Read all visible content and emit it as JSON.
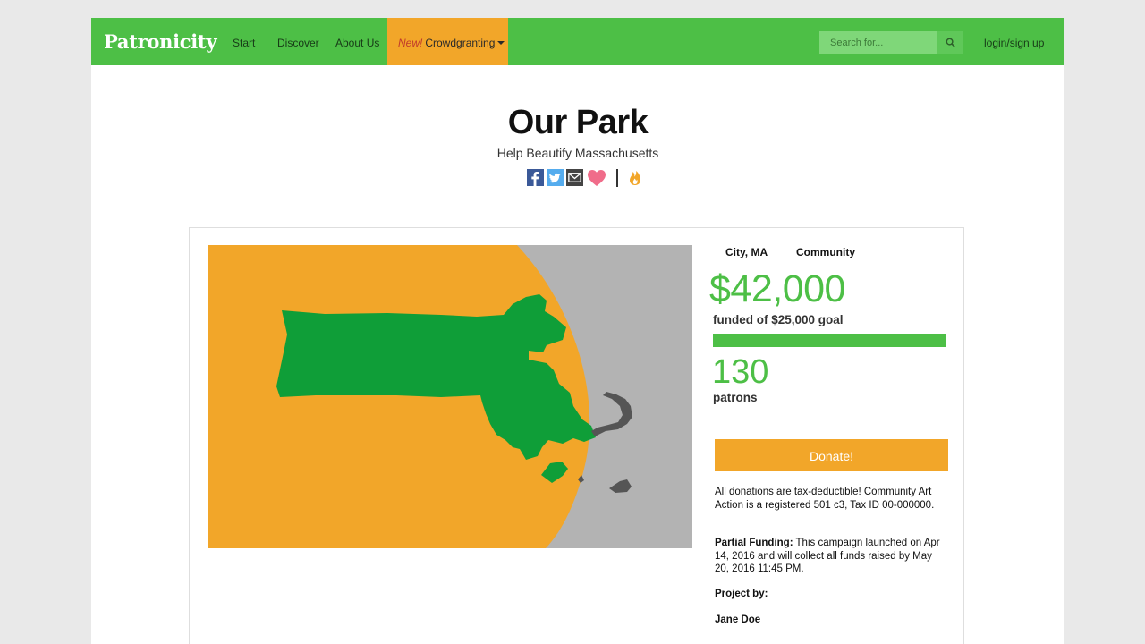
{
  "brand": {
    "name": "Patronicity"
  },
  "nav": {
    "start": "Start",
    "discover": "Discover",
    "about": "About Us",
    "crowd_new": "New!",
    "crowd_label": "Crowdgranting",
    "search_placeholder": "Search for...",
    "login": "login/sign up"
  },
  "project": {
    "title": "Our Park",
    "subtitle": "Help Beautify Massachusetts",
    "share_icons": [
      "facebook-icon",
      "twitter-icon",
      "email-icon",
      "heart-icon",
      "flame-icon"
    ],
    "city": "City, MA",
    "category": "Community",
    "amount": "$42,000",
    "goal_text": "funded of $25,000 goal",
    "progress_percent": 100,
    "patrons_count": "130",
    "patrons_label": "patrons",
    "donate_label": "Donate!",
    "tax_note": "All donations are tax-deductible! Community Art Action is a registered 501 c3, Tax ID 00-000000.",
    "partial_label": "Partial Funding:",
    "partial_text": " This campaign launched on Apr 14, 2016 and will collect all funds raised by May 20, 2016 11:45 PM.",
    "project_by_label": "Project by:",
    "owner": "Jane Doe"
  },
  "colors": {
    "brand_green": "#4dbf46",
    "accent_orange": "#f2a629",
    "map_green": "#0f9e38",
    "map_gray": "#b3b3b3",
    "map_dark": "#555555"
  }
}
